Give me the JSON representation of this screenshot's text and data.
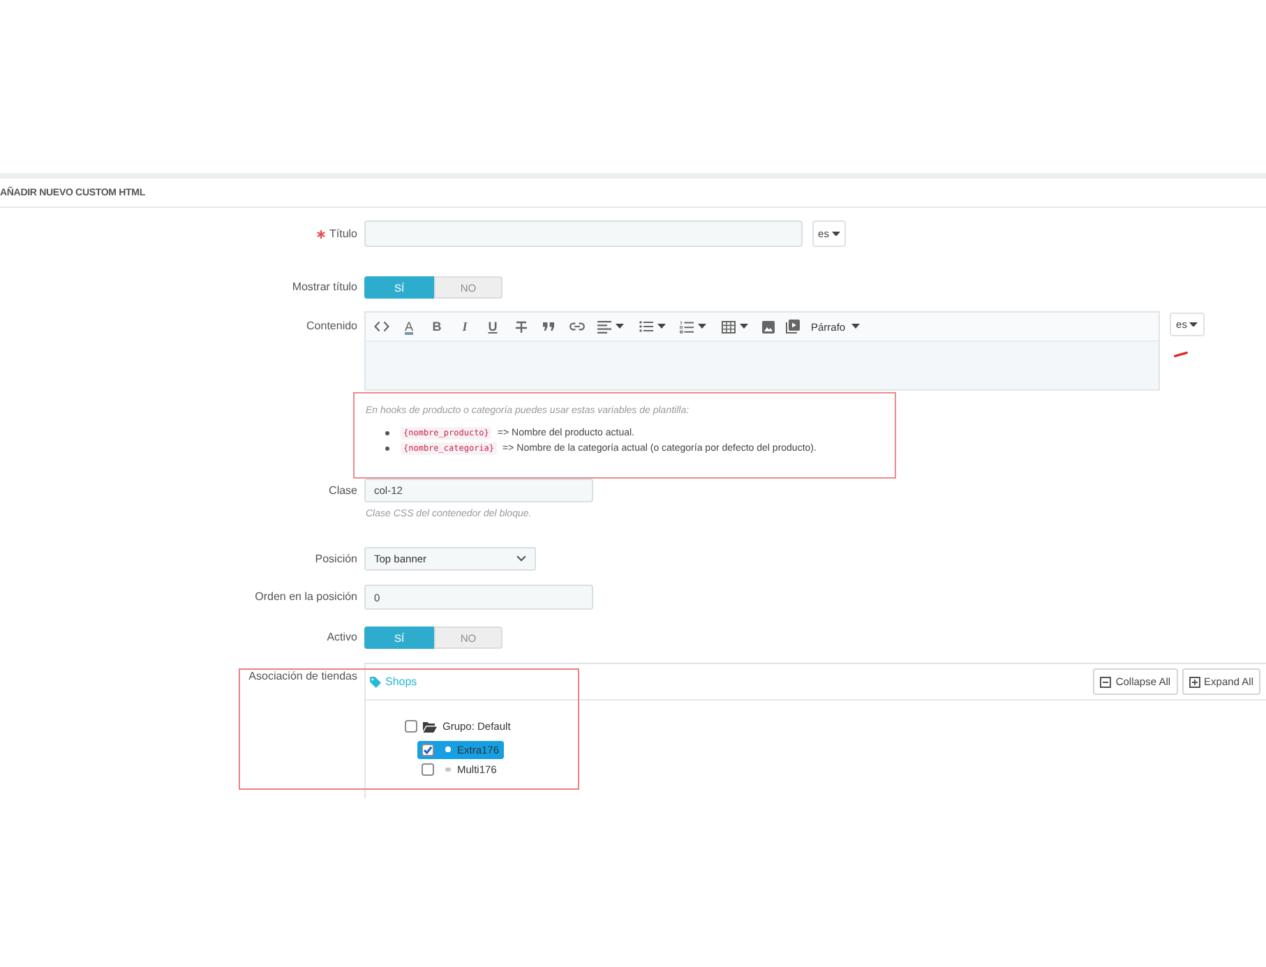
{
  "panel": {
    "title": "AÑADIR NUEVO CUSTOM HTML"
  },
  "form": {
    "title": {
      "label": "Título",
      "required": true,
      "language": "es"
    },
    "show_title": {
      "label": "Mostrar título",
      "options": [
        {
          "label": "SÍ",
          "selected": true
        },
        {
          "label": "NO",
          "selected": false
        }
      ]
    },
    "content": {
      "label": "Contenido",
      "language": "es",
      "marked": true,
      "toolbar": [
        {
          "kind": "source",
          "dropdown": false
        },
        {
          "kind": "color",
          "text": "A",
          "dropdown": false
        },
        {
          "kind": "bold",
          "text": "B",
          "dropdown": false
        },
        {
          "kind": "italic",
          "text": "I",
          "dropdown": false
        },
        {
          "kind": "underline",
          "text": "U",
          "dropdown": false
        },
        {
          "kind": "strike",
          "dropdown": false
        },
        {
          "kind": "quote",
          "dropdown": false
        },
        {
          "kind": "link",
          "dropdown": false
        },
        {
          "kind": "align",
          "dropdown": true
        },
        {
          "kind": "bullets",
          "dropdown": true
        },
        {
          "kind": "numbers",
          "dropdown": true
        },
        {
          "kind": "table",
          "dropdown": true
        },
        {
          "kind": "image",
          "dropdown": false
        },
        {
          "kind": "video",
          "dropdown": false
        },
        {
          "kind": "style",
          "text": "Párrafo",
          "dropdown": true
        }
      ]
    },
    "hint": {
      "highlighted": true,
      "intro": "En hooks de producto o categoría puedes usar estas variables de plantilla:",
      "items": [
        {
          "code": "{nombre_producto}",
          "text": "=> Nombre del producto actual."
        },
        {
          "code": "{nombre_categoria}",
          "text": "=> Nombre de la categoría actual (o categoría por defecto del producto)."
        }
      ]
    },
    "css_class": {
      "label": "Clase",
      "value": "col-12",
      "help": "Clase CSS del contenedor del bloque."
    },
    "position": {
      "label": "Posición",
      "value": "Top banner"
    },
    "order": {
      "label": "Orden en la posición",
      "value": "0"
    },
    "active": {
      "label": "Activo",
      "options": [
        {
          "label": "SÍ",
          "selected": true
        },
        {
          "label": "NO",
          "selected": false
        }
      ]
    },
    "shop_association": {
      "label": "Asociación de tiendas",
      "highlighted": true,
      "heading": "Shops",
      "buttons": [
        {
          "kind": "collapse",
          "label": "Collapse All"
        },
        {
          "kind": "expand",
          "label": "Expand All"
        }
      ],
      "tree": [
        {
          "label": "Grupo: Default",
          "checked": false,
          "selected": false,
          "children": [
            {
              "label": "Extra176",
              "checked": true,
              "selected": true
            },
            {
              "label": "Multi176",
              "checked": false,
              "selected": false
            }
          ]
        }
      ]
    }
  }
}
